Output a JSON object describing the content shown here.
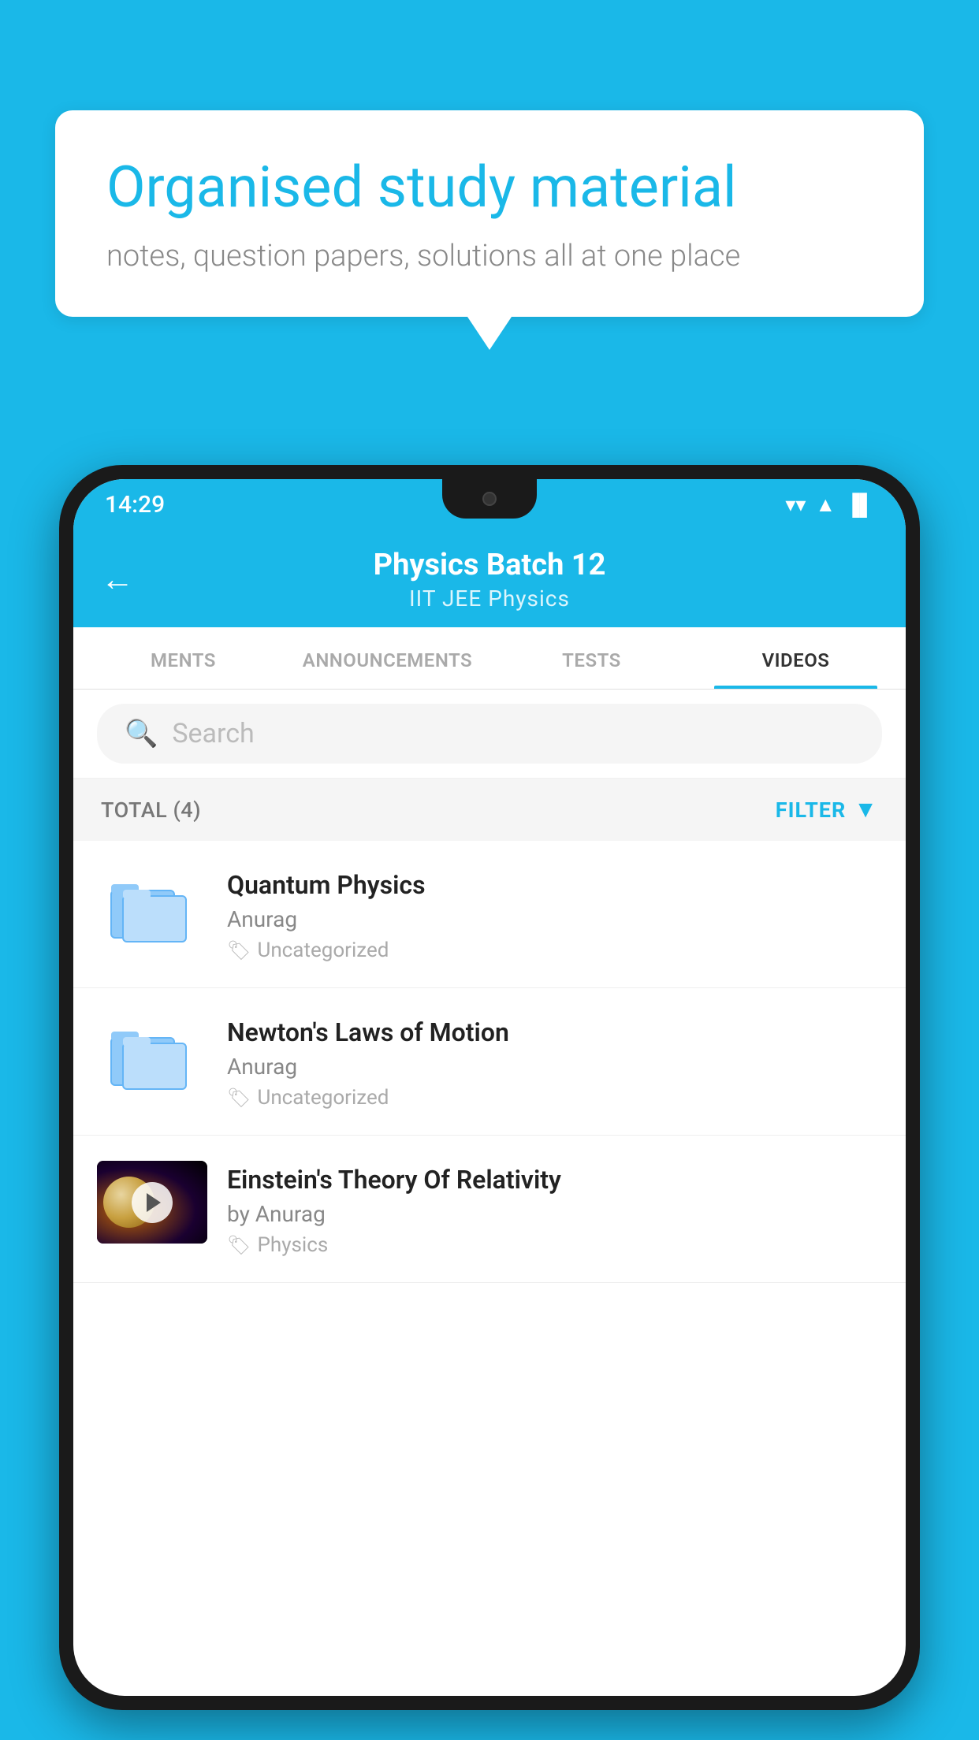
{
  "background": {
    "color": "#1ab8e8"
  },
  "hero": {
    "title": "Organised study material",
    "subtitle": "notes, question papers, solutions all at one place"
  },
  "phone": {
    "status_bar": {
      "time": "14:29",
      "wifi": "▼",
      "signal": "▲",
      "battery": "▐"
    },
    "header": {
      "title": "Physics Batch 12",
      "subtitle": "IIT JEE   Physics",
      "back_label": "←"
    },
    "tabs": [
      {
        "label": "MENTS",
        "active": false
      },
      {
        "label": "ANNOUNCEMENTS",
        "active": false
      },
      {
        "label": "TESTS",
        "active": false
      },
      {
        "label": "VIDEOS",
        "active": true
      }
    ],
    "search": {
      "placeholder": "Search"
    },
    "filter": {
      "total_label": "TOTAL (4)",
      "button_label": "FILTER"
    },
    "videos": [
      {
        "id": 1,
        "title": "Quantum Physics",
        "author": "Anurag",
        "tag": "Uncategorized",
        "has_thumbnail": false
      },
      {
        "id": 2,
        "title": "Newton's Laws of Motion",
        "author": "Anurag",
        "tag": "Uncategorized",
        "has_thumbnail": false
      },
      {
        "id": 3,
        "title": "Einstein's Theory Of Relativity",
        "author": "by Anurag",
        "tag": "Physics",
        "has_thumbnail": true
      }
    ]
  }
}
